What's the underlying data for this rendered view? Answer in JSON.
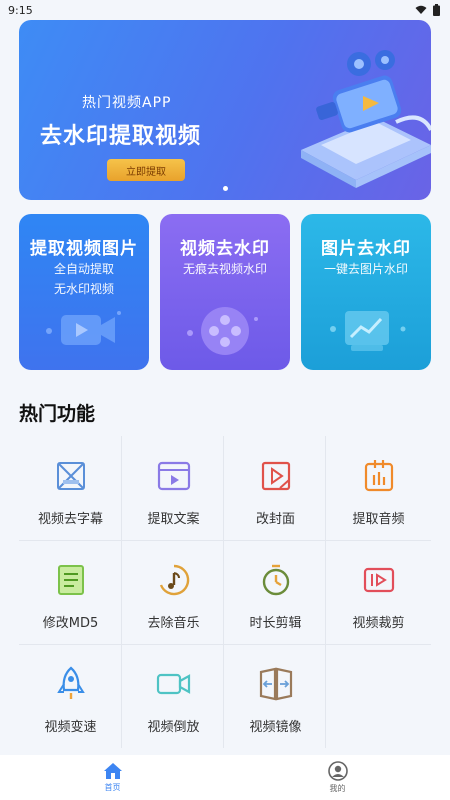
{
  "status_bar": {
    "time": "9:15"
  },
  "banner": {
    "subtitle": "热门视频APP",
    "title": "去水印提取视频",
    "button_label": "立即提取"
  },
  "cards": [
    {
      "title": "提取视频图片",
      "lines": [
        "全自动提取",
        "无水印视频"
      ],
      "icon": "video-camera-icon"
    },
    {
      "title": "视频去水印",
      "lines": [
        "无痕去视频水印"
      ],
      "icon": "film-reel-icon"
    },
    {
      "title": "图片去水印",
      "lines": [
        "一键去图片水印"
      ],
      "icon": "image-chart-icon"
    }
  ],
  "section": {
    "title": "热门功能"
  },
  "features": [
    {
      "label": "视频去字幕",
      "icon": "subtitle-remove-icon",
      "color": "#5a8fd8"
    },
    {
      "label": "提取文案",
      "icon": "copy-extract-icon",
      "color": "#8a7ae6"
    },
    {
      "label": "改封面",
      "icon": "cover-icon",
      "color": "#e0524a"
    },
    {
      "label": "提取音频",
      "icon": "audio-extract-icon",
      "color": "#f08a2a"
    },
    {
      "label": "修改MD5",
      "icon": "md5-icon",
      "color": "#7cc24a"
    },
    {
      "label": "去除音乐",
      "icon": "music-remove-icon",
      "color": "#e0a23a"
    },
    {
      "label": "时长剪辑",
      "icon": "timer-icon",
      "color": "#6b8c3a"
    },
    {
      "label": "视频裁剪",
      "icon": "video-crop-icon",
      "color": "#e24e5a"
    },
    {
      "label": "视频变速",
      "icon": "rocket-icon",
      "color": "#3a8ee8"
    },
    {
      "label": "视频倒放",
      "icon": "video-reverse-icon",
      "color": "#4ec3c4"
    },
    {
      "label": "视频镜像",
      "icon": "mirror-icon",
      "color": "#9a7a5a"
    }
  ],
  "tabbar": {
    "tabs": [
      {
        "label": "首页",
        "icon": "home-icon",
        "active": true
      },
      {
        "label": "我的",
        "icon": "profile-icon",
        "active": false
      }
    ]
  }
}
